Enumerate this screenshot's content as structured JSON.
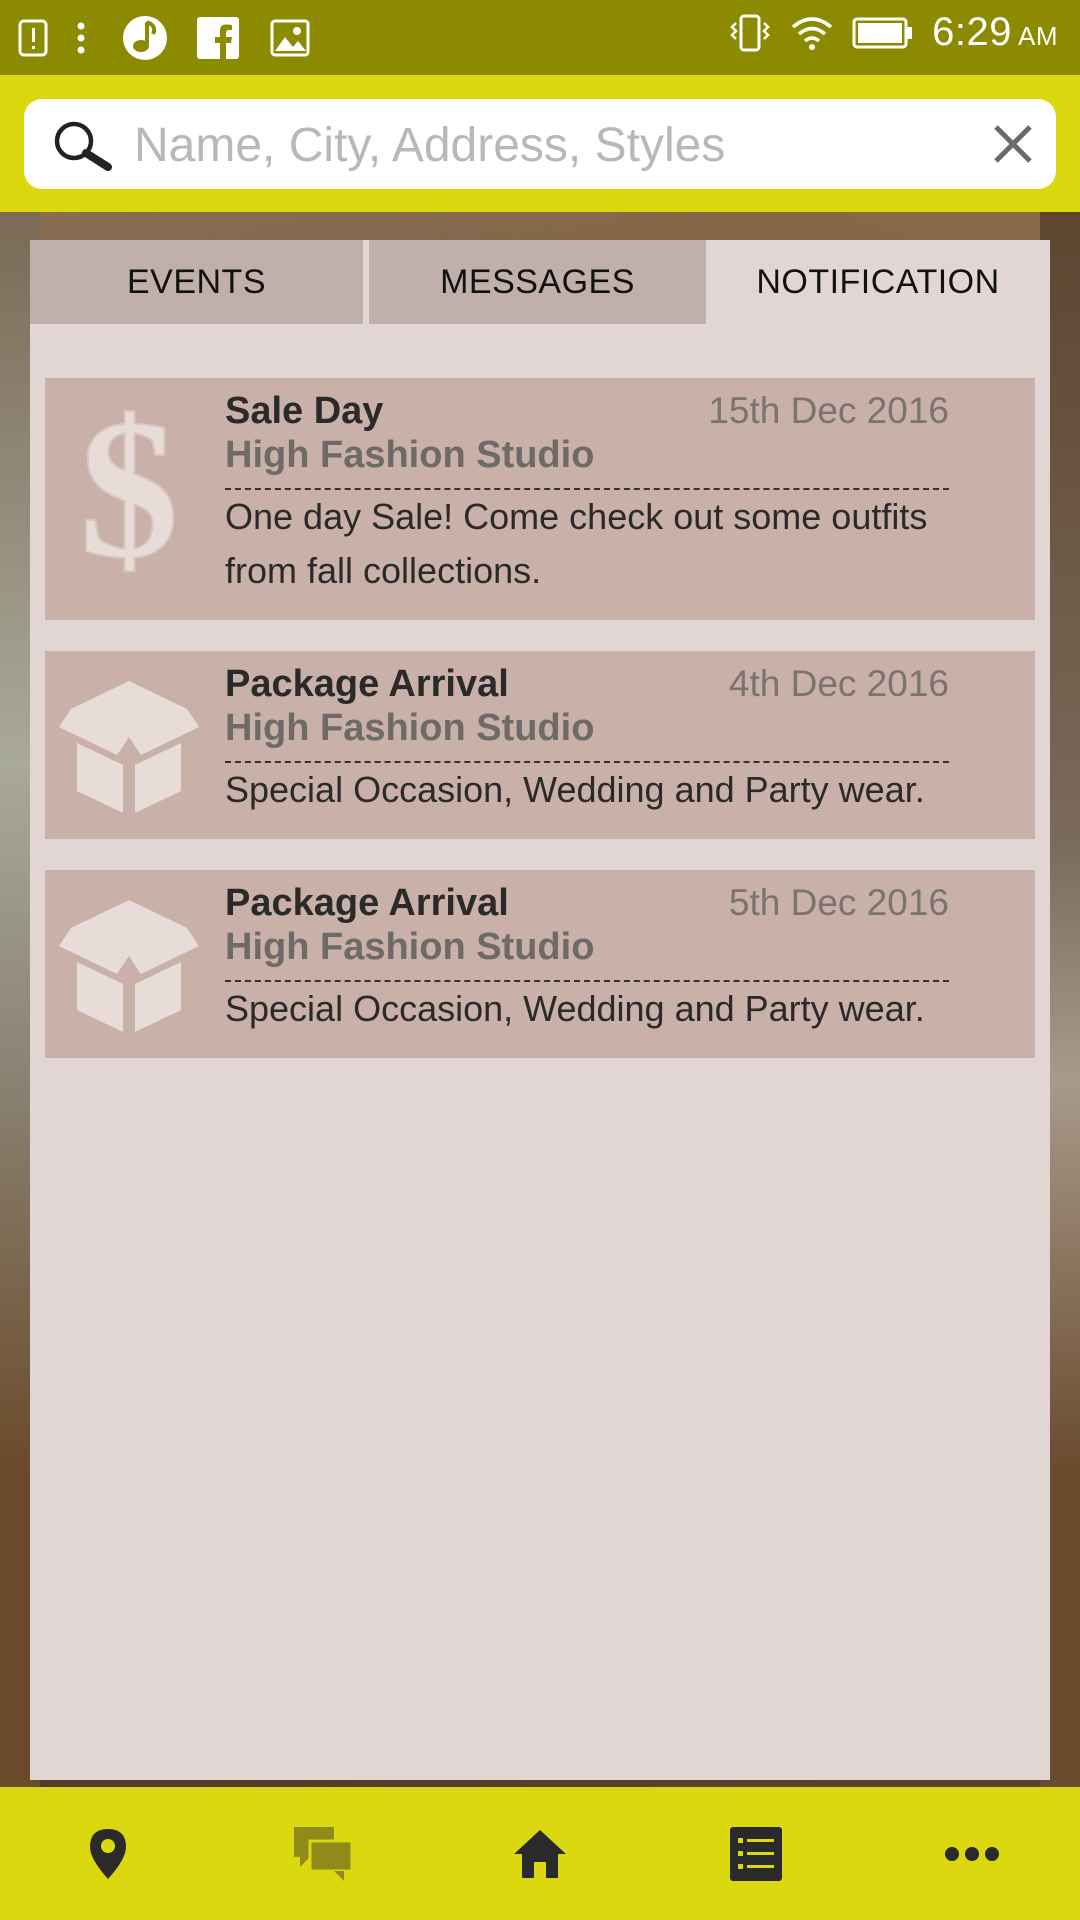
{
  "status_bar": {
    "time": "6:29",
    "ampm": "AM",
    "left_icons": [
      "alert-icon",
      "more-vert-icon",
      "music-icon",
      "facebook-icon",
      "image-icon"
    ],
    "right_icons": [
      "vibrate-icon",
      "wifi-icon",
      "battery-icon"
    ]
  },
  "search": {
    "placeholder": "Name, City, Address, Styles",
    "value": ""
  },
  "tabs": [
    {
      "label": "EVENTS"
    },
    {
      "label": "MESSAGES"
    },
    {
      "label": "NOTIFICATION",
      "active": true
    }
  ],
  "notifications": [
    {
      "icon": "dollar-icon",
      "title": "Sale Day",
      "date": "15th Dec 2016",
      "studio": "High Fashion Studio",
      "body": "One day Sale! Come check out some outfits from fall collections."
    },
    {
      "icon": "package-icon",
      "title": "Package Arrival",
      "date": "4th Dec 2016",
      "studio": "High Fashion Studio",
      "body": "Special Occasion, Wedding and Party wear."
    },
    {
      "icon": "package-icon",
      "title": "Package Arrival",
      "date": "5th Dec 2016",
      "studio": "High Fashion Studio",
      "body": "Special Occasion, Wedding and Party wear."
    }
  ],
  "bottom_nav": [
    "map-pin-icon",
    "chat-icon",
    "home-icon",
    "list-icon",
    "more-icon"
  ],
  "colors": {
    "accent": "#dcd80f",
    "statusbar": "#8b8a00",
    "card": "#c9b0a8",
    "panel": "#e1d6d3"
  }
}
